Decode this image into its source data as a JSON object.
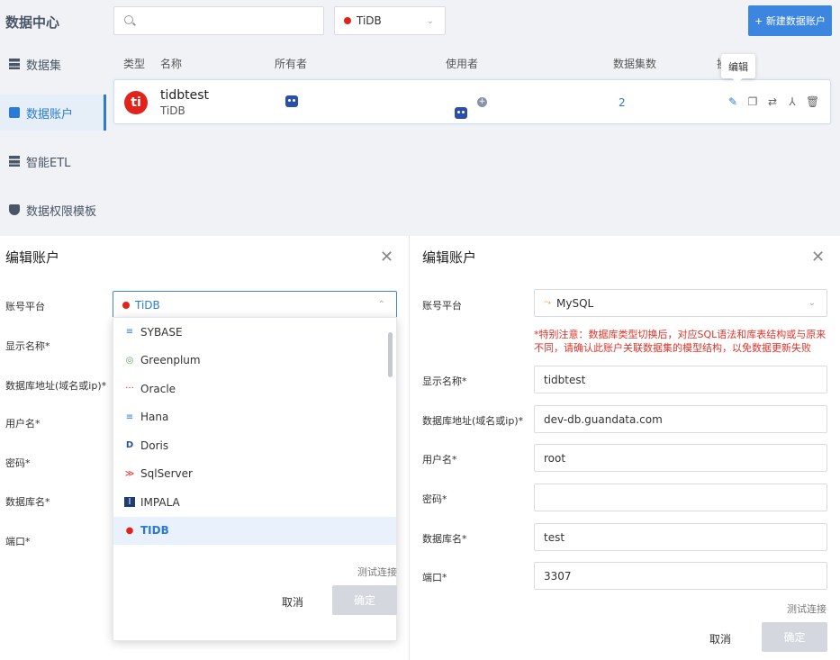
{
  "sidebar": {
    "title": "数据中心",
    "items": [
      {
        "label": "数据集"
      },
      {
        "label": "数据账户"
      },
      {
        "label": "智能ETL"
      },
      {
        "label": "数据权限模板"
      }
    ]
  },
  "toolbar": {
    "search_placeholder": "",
    "filter_value": "TiDB",
    "new_button": "+ 新建数据账户"
  },
  "table": {
    "headers": [
      "类型",
      "名称",
      "所有者",
      "使用者",
      "数据集数",
      "操"
    ],
    "row": {
      "name": "tidbtest",
      "type": "TiDB",
      "dataset_count": "2"
    },
    "tooltip": "编辑"
  },
  "dialog_left": {
    "title": "编辑账户",
    "labels": [
      "账号平台",
      "显示名称*",
      "数据库地址(域名或ip)*",
      "用户名*",
      "密码*",
      "数据库名*",
      "端口*"
    ],
    "platform_value": "TiDB",
    "options": [
      {
        "label": "SYBASE",
        "icon": "≡"
      },
      {
        "label": "Greenplum",
        "icon": "◎"
      },
      {
        "label": "Oracle",
        "icon": "···"
      },
      {
        "label": "Hana",
        "icon": "≡"
      },
      {
        "label": "Doris",
        "icon": "D"
      },
      {
        "label": "SqlServer",
        "icon": "≫"
      },
      {
        "label": "IMPALA",
        "icon": "I"
      },
      {
        "label": "TIDB",
        "icon": "●"
      }
    ],
    "test_link": "测试连接",
    "cancel": "取消",
    "ok": "确定"
  },
  "dialog_right": {
    "title": "编辑账户",
    "platform_label": "账号平台",
    "platform_value": "MySQL",
    "warning": "*特别注意：数据库类型切换后，对应SQL语法和库表结构或与原来不同，请确认此账户关联数据集的模型结构，以免数据更新失败",
    "fields": [
      {
        "label": "显示名称*",
        "value": "tidbtest"
      },
      {
        "label": "数据库地址(域名或ip)*",
        "value": "dev-db.guandata.com"
      },
      {
        "label": "用户名*",
        "value": "root"
      },
      {
        "label": "密码*",
        "value": ""
      },
      {
        "label": "数据库名*",
        "value": "test"
      },
      {
        "label": "端口*",
        "value": "3307"
      }
    ],
    "test_link": "测试连接",
    "cancel": "取消",
    "ok": "确定"
  },
  "colors": {
    "accent": "#3c86df",
    "tidb": "#e2231a",
    "warning": "#e0342a"
  }
}
